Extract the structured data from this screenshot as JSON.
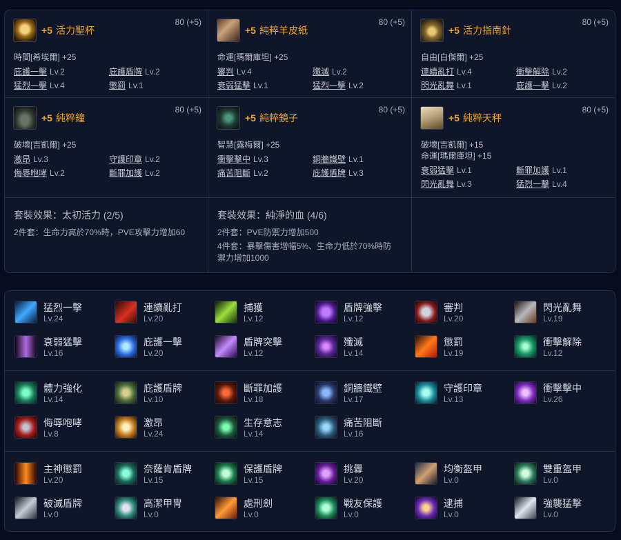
{
  "cards": [
    {
      "icon": "holy-grail-icon",
      "plus": "+5",
      "name": "活力聖杯",
      "level": "80 (+5)",
      "stats": [
        "時間[希埃爾] +25"
      ],
      "skills": [
        {
          "name": "庇護一擊",
          "lv": "Lv.2"
        },
        {
          "name": "庇護盾牌",
          "lv": "Lv.2"
        },
        {
          "name": "猛烈一擊",
          "lv": "Lv.4"
        },
        {
          "name": "懲罰",
          "lv": "Lv.1"
        }
      ]
    },
    {
      "icon": "parchment-icon",
      "plus": "+5",
      "name": "純粹羊皮紙",
      "level": "80 (+5)",
      "stats": [
        "命運[瑪爾庫坦] +25"
      ],
      "skills": [
        {
          "name": "審判",
          "lv": "Lv.4"
        },
        {
          "name": "殲滅",
          "lv": "Lv.2"
        },
        {
          "name": "衰弱猛擊",
          "lv": "Lv.1"
        },
        {
          "name": "猛烈一擊",
          "lv": "Lv.2"
        }
      ]
    },
    {
      "icon": "compass-icon",
      "plus": "+5",
      "name": "活力指南針",
      "level": "80 (+5)",
      "stats": [
        "自由[白傑爾] +25"
      ],
      "skills": [
        {
          "name": "連續亂打",
          "lv": "Lv.4"
        },
        {
          "name": "衝擊解除",
          "lv": "Lv.2"
        },
        {
          "name": "閃光亂舞",
          "lv": "Lv.1"
        },
        {
          "name": "庇護一擊",
          "lv": "Lv.2"
        }
      ]
    },
    {
      "icon": "bell-icon",
      "plus": "+5",
      "name": "純粹鐘",
      "level": "80 (+5)",
      "stats": [
        "破壞[吉凱爾] +25"
      ],
      "skills": [
        {
          "name": "激昂",
          "lv": "Lv.3"
        },
        {
          "name": "守護印章",
          "lv": "Lv.2"
        },
        {
          "name": "侮辱咆哮",
          "lv": "Lv.2"
        },
        {
          "name": "斷罪加護",
          "lv": "Lv.2"
        }
      ]
    },
    {
      "icon": "mirror-icon",
      "plus": "+5",
      "name": "純粹鏡子",
      "level": "80 (+5)",
      "stats": [
        "智慧[露梅爾] +25"
      ],
      "skills": [
        {
          "name": "衝擊擊中",
          "lv": "Lv.3"
        },
        {
          "name": "銅牆鐵壁",
          "lv": "Lv.1"
        },
        {
          "name": "痛苦阻斷",
          "lv": "Lv.2"
        },
        {
          "name": "庇護盾牌",
          "lv": "Lv.3"
        }
      ]
    },
    {
      "icon": "scale-icon",
      "plus": "+5",
      "name": "純粹天秤",
      "level": "80 (+5)",
      "stats": [
        "破壞[吉凱爾] +15",
        "命運[瑪爾庫坦] +15"
      ],
      "skills": [
        {
          "name": "衰弱猛擊",
          "lv": "Lv.1"
        },
        {
          "name": "斷罪加護",
          "lv": "Lv.1"
        },
        {
          "name": "閃光亂舞",
          "lv": "Lv.3"
        },
        {
          "name": "猛烈一擊",
          "lv": "Lv.4"
        }
      ]
    }
  ],
  "sets": [
    {
      "title": "套裝效果：太初活力 (2/5)",
      "lines": [
        "2件套：生命力高於70%時，PVE攻擊力增加60"
      ]
    },
    {
      "title": "套裝效果：純淨的血 (4/6)",
      "lines": [
        "2件套：PVE防禦力增加500",
        "4件套：暴擊傷害增幅5%、生命力低於70%時防",
        "禦力增加1000"
      ]
    }
  ],
  "skill_groups": [
    [
      {
        "name": "猛烈一擊",
        "lv": "Lv.24",
        "icon": "blue-slash-icon"
      },
      {
        "name": "連續亂打",
        "lv": "Lv.20",
        "icon": "red-strike-icon"
      },
      {
        "name": "捕獲",
        "lv": "Lv.12",
        "icon": "green-hook-icon"
      },
      {
        "name": "盾牌強擊",
        "lv": "Lv.12",
        "icon": "purple-shield-bash-icon"
      },
      {
        "name": "審判",
        "lv": "Lv.20",
        "icon": "judgment-shield-icon"
      },
      {
        "name": "閃光亂舞",
        "lv": "Lv.19",
        "icon": "flash-dance-icon"
      },
      {
        "name": "衰弱猛擊",
        "lv": "Lv.16",
        "icon": "purple-pillar-icon"
      },
      {
        "name": "庇護一擊",
        "lv": "Lv.20",
        "icon": "blue-rune-icon"
      },
      {
        "name": "盾牌突擊",
        "lv": "Lv.12",
        "icon": "purple-blade-icon"
      },
      {
        "name": "殲滅",
        "lv": "Lv.14",
        "icon": "annihilate-icon"
      },
      {
        "name": "懲罰",
        "lv": "Lv.19",
        "icon": "fire-sweep-icon"
      },
      {
        "name": "衝擊解除",
        "lv": "Lv.12",
        "icon": "green-burst-icon"
      }
    ],
    [
      {
        "name": "體力強化",
        "lv": "Lv.14",
        "icon": "vitality-icon"
      },
      {
        "name": "庇護盾牌",
        "lv": "Lv.10",
        "icon": "protect-shield-icon"
      },
      {
        "name": "斷罪加護",
        "lv": "Lv.18",
        "icon": "condemn-icon"
      },
      {
        "name": "銅牆鐵壁",
        "lv": "Lv.17",
        "icon": "iron-wall-icon"
      },
      {
        "name": "守護印章",
        "lv": "Lv.13",
        "icon": "guard-seal-icon"
      },
      {
        "name": "衝擊擊中",
        "lv": "Lv.26",
        "icon": "impact-hit-icon"
      },
      {
        "name": "侮辱咆哮",
        "lv": "Lv.8",
        "icon": "roar-icon"
      },
      {
        "name": "激昂",
        "lv": "Lv.24",
        "icon": "fervor-icon"
      },
      {
        "name": "生存意志",
        "lv": "Lv.14",
        "icon": "survival-icon"
      },
      {
        "name": "痛苦阻斷",
        "lv": "Lv.16",
        "icon": "pain-block-icon"
      }
    ],
    [
      {
        "name": "主神懲罰",
        "lv": "Lv.20",
        "icon": "god-punish-icon"
      },
      {
        "name": "奈薩肯盾牌",
        "lv": "Lv.15",
        "icon": "nezakan-shield-icon"
      },
      {
        "name": "保護盾牌",
        "lv": "Lv.15",
        "icon": "guard-shield-icon"
      },
      {
        "name": "挑釁",
        "lv": "Lv.20",
        "icon": "provoke-icon"
      },
      {
        "name": "均衡盔甲",
        "lv": "Lv.0",
        "icon": "balance-armor-icon"
      },
      {
        "name": "雙重盔甲",
        "lv": "Lv.0",
        "icon": "double-armor-icon"
      },
      {
        "name": "破滅盾牌",
        "lv": "Lv.0",
        "icon": "ruin-shield-icon"
      },
      {
        "name": "高潔甲冑",
        "lv": "Lv.0",
        "icon": "noble-armor-icon"
      },
      {
        "name": "處刑劍",
        "lv": "Lv.0",
        "icon": "execution-sword-icon"
      },
      {
        "name": "戰友保護",
        "lv": "Lv.0",
        "icon": "ally-protect-icon"
      },
      {
        "name": "逮捕",
        "lv": "Lv.0",
        "icon": "arrest-icon"
      },
      {
        "name": "強襲猛擊",
        "lv": "Lv.0",
        "icon": "assault-icon"
      }
    ]
  ]
}
